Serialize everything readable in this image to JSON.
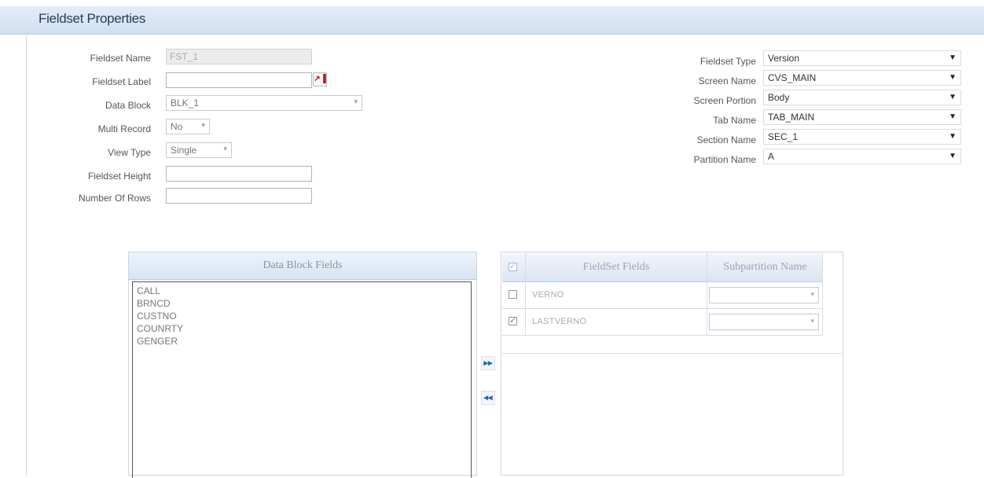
{
  "header": {
    "title": "Fieldset Properties"
  },
  "form_left": {
    "fieldset_name": {
      "label": "Fieldset Name",
      "value": "FST_1"
    },
    "fieldset_label": {
      "label": "Fieldset Label",
      "value": ""
    },
    "data_block": {
      "label": "Data Block",
      "value": "BLK_1"
    },
    "multi_record": {
      "label": "Multi Record",
      "value": "No"
    },
    "view_type": {
      "label": "View Type",
      "value": "Single"
    },
    "fieldset_height": {
      "label": "Fieldset Height",
      "value": ""
    },
    "number_of_rows": {
      "label": "Number Of Rows",
      "value": ""
    }
  },
  "form_right": {
    "fieldset_type": {
      "label": "Fieldset Type",
      "value": "Version"
    },
    "screen_name": {
      "label": "Screen Name",
      "value": "CVS_MAIN"
    },
    "screen_portion": {
      "label": "Screen Portion",
      "value": "Body"
    },
    "tab_name": {
      "label": "Tab Name",
      "value": "TAB_MAIN"
    },
    "section_name": {
      "label": "Section Name",
      "value": "SEC_1"
    },
    "partition_name": {
      "label": "Partition Name",
      "value": "A"
    }
  },
  "data_block_fields": {
    "header": "Data Block Fields",
    "items": [
      "CALL",
      "BRNCD",
      "CUSTNO",
      "COUNRTY",
      "GENGER"
    ]
  },
  "fieldset_fields": {
    "headers": {
      "fields": "FieldSet Fields",
      "subpartition": "Subpartition Name"
    },
    "rows": [
      {
        "name": "VERNO",
        "checked": false,
        "subpartition": ""
      },
      {
        "name": "LASTVERNO",
        "checked": true,
        "subpartition": ""
      }
    ]
  },
  "icons": {
    "move_right": "double-arrow-right-icon",
    "move_left": "double-arrow-left-icon",
    "lov": "lov-search-icon",
    "caret": "caret-down-icon",
    "check": "checkmark-icon"
  },
  "colors": {
    "header_bg": "#d6e3f2",
    "title_text": "#2a3d56",
    "move_button": "#2d63b8"
  }
}
